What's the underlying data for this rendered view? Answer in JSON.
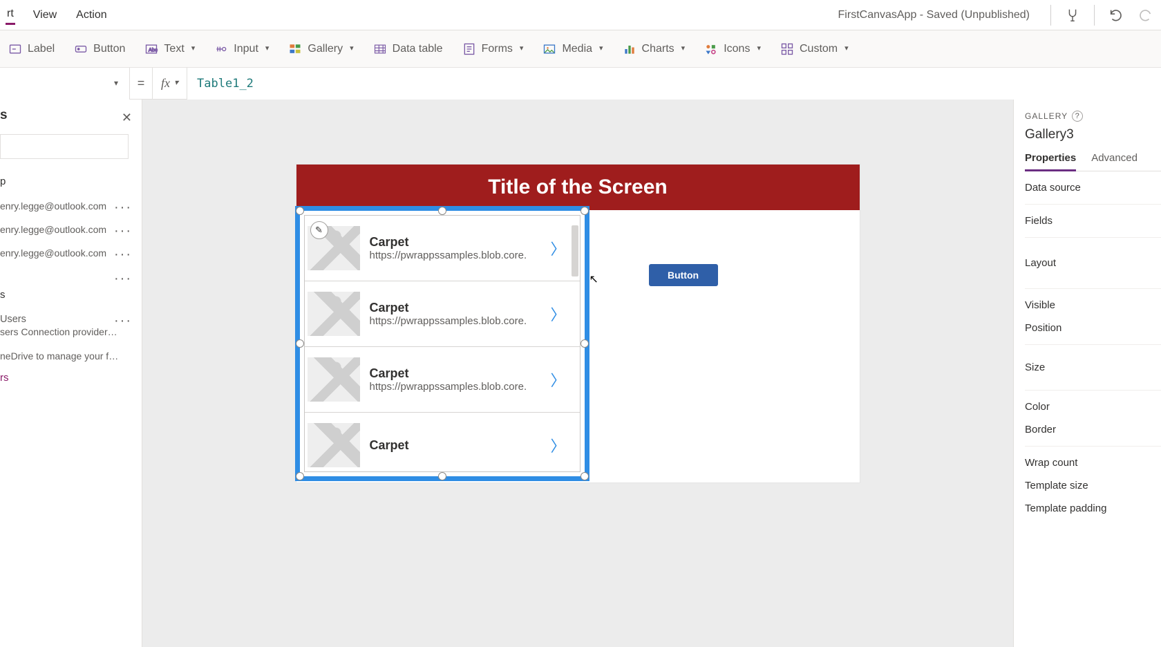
{
  "menubar": {
    "items": [
      "rt",
      "View",
      "Action"
    ],
    "active_index": 0,
    "app_status": "FirstCanvasApp - Saved (Unpublished)"
  },
  "toolbar": {
    "label_label": "Label",
    "button_label": "Button",
    "text_label": "Text",
    "input_label": "Input",
    "gallery_label": "Gallery",
    "datatable_label": "Data table",
    "forms_label": "Forms",
    "media_label": "Media",
    "charts_label": "Charts",
    "icons_label": "Icons",
    "custom_label": "Custom"
  },
  "formula": {
    "value": "Table1_2"
  },
  "sources": {
    "title": "s",
    "section_head": "p",
    "conn_items": [
      {
        "line": "enry.legge@outlook.com"
      },
      {
        "line": "enry.legge@outlook.com"
      },
      {
        "line": "enry.legge@outlook.com"
      },
      {
        "line": ""
      }
    ],
    "cat_head": "s",
    "cat_items": [
      {
        "title": "Users",
        "desc": "sers Connection provider lets you ..."
      },
      {
        "title": "",
        "desc": "neDrive to manage your files. Yo..."
      }
    ],
    "add_connector": "rs"
  },
  "canvas": {
    "screen_title": "Title of the Screen",
    "button_label": "Button",
    "gallery_items": [
      {
        "title": "Carpet",
        "sub": "https://pwrappssamples.blob.core."
      },
      {
        "title": "Carpet",
        "sub": "https://pwrappssamples.blob.core."
      },
      {
        "title": "Carpet",
        "sub": "https://pwrappssamples.blob.core."
      },
      {
        "title": "Carpet",
        "sub": ""
      }
    ]
  },
  "props": {
    "panel_label": "GALLERY",
    "control_name": "Gallery3",
    "tabs": [
      "Properties",
      "Advanced"
    ],
    "active_tab": 0,
    "rows": [
      "Data source",
      "Fields",
      "Layout",
      "Visible",
      "Position",
      "Size",
      "Color",
      "Border",
      "Wrap count",
      "Template size",
      "Template padding"
    ]
  }
}
